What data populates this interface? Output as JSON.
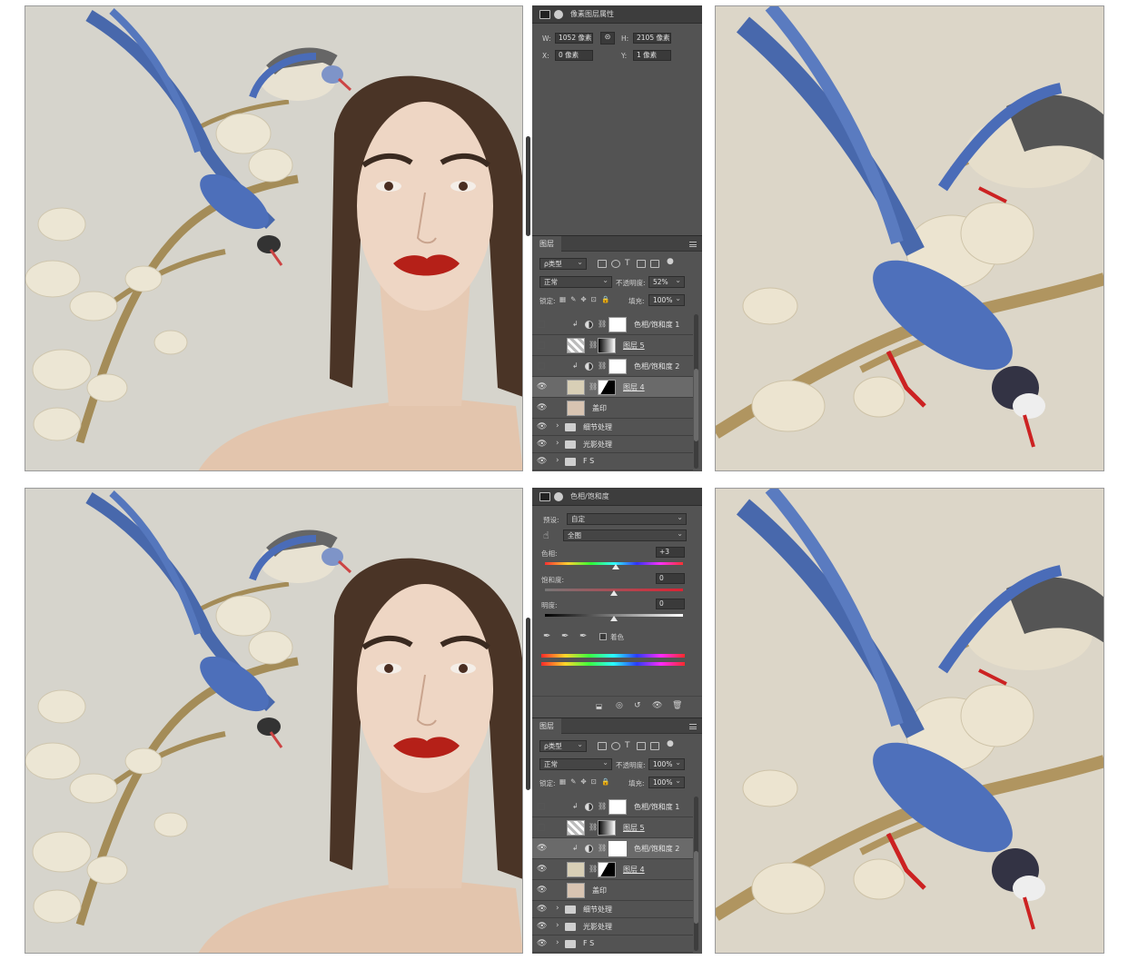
{
  "colors": {
    "panel": "#535353",
    "panel_dark": "#3d3d3d",
    "canvas_bg": "#d9d7d0",
    "lips": "#b52018",
    "bird_blue": "#4a6cb8"
  },
  "top": {
    "props": {
      "title": "像素图层属性",
      "w_label": "W:",
      "w_value": "1052 像素",
      "h_label": "H:",
      "h_value": "2105 像素",
      "x_label": "X:",
      "x_value": "0 像素",
      "y_label": "Y:",
      "y_value": "1 像素"
    },
    "layers": {
      "tab": "图层",
      "filter": "ρ类型",
      "blend": "正常",
      "opacity_label": "不透明度:",
      "opacity": "52%",
      "lock_label": "锁定:",
      "fill_label": "填充:",
      "fill": "100%",
      "rows": [
        {
          "name": "色相/饱和度 1",
          "visible": false,
          "kind": "adj"
        },
        {
          "name": "图层 5",
          "visible": false,
          "kind": "pixel"
        },
        {
          "name": "色相/饱和度 2",
          "visible": false,
          "kind": "adj"
        },
        {
          "name": "图层 4",
          "visible": true,
          "kind": "pixel",
          "selected": true
        },
        {
          "name": "盖印",
          "visible": true,
          "kind": "stamp"
        },
        {
          "name": "细节处理",
          "visible": true,
          "kind": "group"
        },
        {
          "name": "光影处理",
          "visible": true,
          "kind": "group"
        },
        {
          "name": "F S",
          "visible": true,
          "kind": "group"
        }
      ]
    }
  },
  "bottom": {
    "props": {
      "title": "色相/饱和度",
      "preset_label": "预设:",
      "preset": "自定",
      "channel": "全图",
      "hue_label": "色相:",
      "hue": "+3",
      "sat_label": "饱和度:",
      "sat": "0",
      "light_label": "明度:",
      "light": "0",
      "colorize_label": "着色"
    },
    "layers": {
      "tab": "图层",
      "filter": "ρ类型",
      "blend": "正常",
      "opacity_label": "不透明度:",
      "opacity": "100%",
      "lock_label": "锁定:",
      "fill_label": "填充:",
      "fill": "100%",
      "rows": [
        {
          "name": "色相/饱和度 1",
          "visible": false,
          "kind": "adj"
        },
        {
          "name": "图层 5",
          "visible": false,
          "kind": "pixel"
        },
        {
          "name": "色相/饱和度 2",
          "visible": true,
          "kind": "adj",
          "selected": true
        },
        {
          "name": "图层 4",
          "visible": true,
          "kind": "pixel"
        },
        {
          "name": "盖印",
          "visible": true,
          "kind": "stamp"
        },
        {
          "name": "细节处理",
          "visible": true,
          "kind": "group"
        },
        {
          "name": "光影处理",
          "visible": true,
          "kind": "group"
        },
        {
          "name": "F S",
          "visible": true,
          "kind": "group"
        }
      ]
    }
  }
}
